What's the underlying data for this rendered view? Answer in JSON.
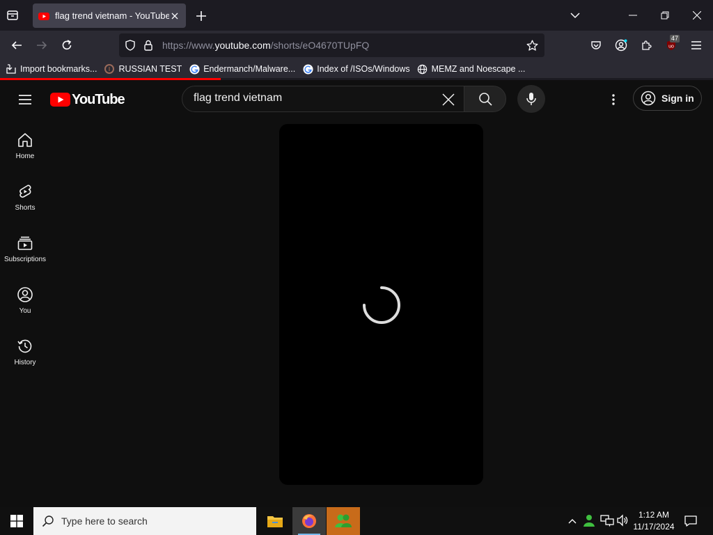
{
  "browser": {
    "tab_title": "flag trend vietnam - YouTube",
    "url_prefix": "https://www.",
    "url_domain": "youtube.com",
    "url_path": "/shorts/eO4670TUpFQ",
    "extension_badge": "47",
    "page_load_progress": 0.31,
    "bookmarks": [
      {
        "label": "Import bookmarks...",
        "icon": "import-icon"
      },
      {
        "label": "RUSSIAN TEST",
        "icon": "site-favicon"
      },
      {
        "label": "Endermanch/Malware...",
        "icon": "google-icon"
      },
      {
        "label": "Index of /ISOs/Windows",
        "icon": "google-icon"
      },
      {
        "label": "MEMZ and Noescape ...",
        "icon": "globe-icon"
      }
    ]
  },
  "youtube": {
    "logo_text": "YouTube",
    "search_value": "flag trend vietnam",
    "search_placeholder": "Search",
    "sign_in_label": "Sign in",
    "sidebar": [
      {
        "label": "Home",
        "icon": "home-icon"
      },
      {
        "label": "Shorts",
        "icon": "shorts-icon"
      },
      {
        "label": "Subscriptions",
        "icon": "subscriptions-icon"
      },
      {
        "label": "You",
        "icon": "you-icon"
      },
      {
        "label": "History",
        "icon": "history-icon"
      }
    ]
  },
  "taskbar": {
    "search_placeholder": "Type here to search",
    "time": "1:12 AM",
    "date": "11/17/2024"
  },
  "colors": {
    "youtube_red": "#ff0000",
    "page_bg": "#0f0f0f",
    "browser_chrome": "#2b2a33"
  }
}
